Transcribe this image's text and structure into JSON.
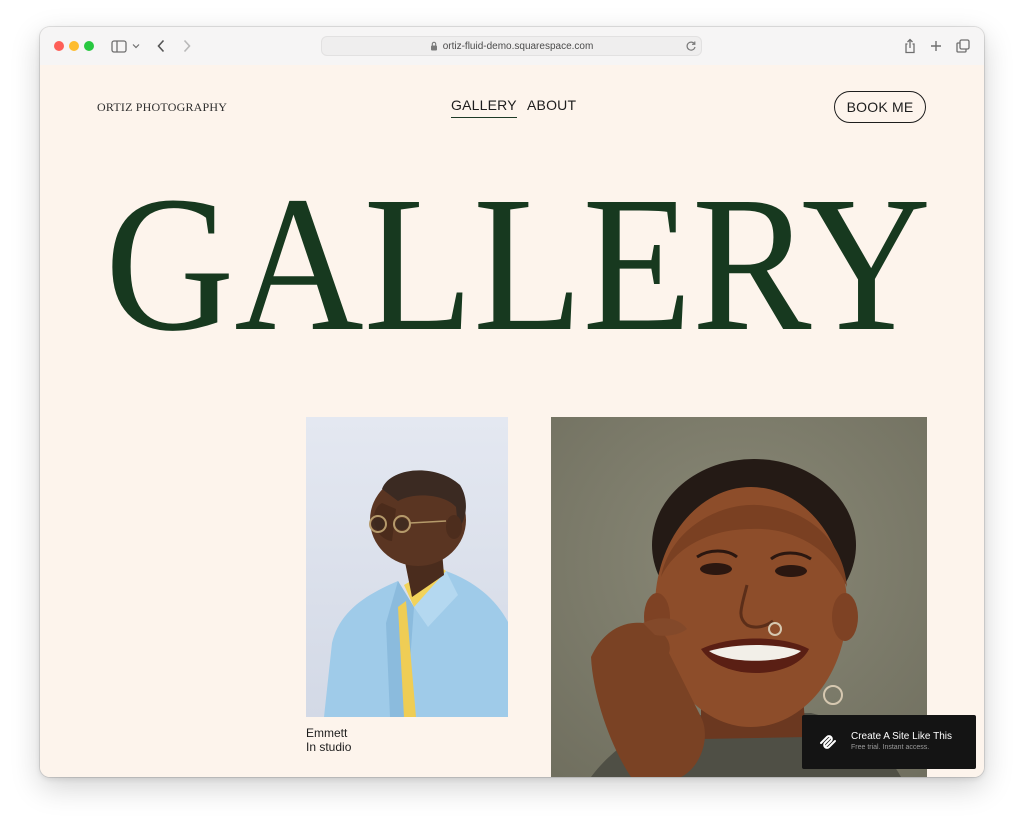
{
  "browser": {
    "url": "ortiz-fluid-demo.squarespace.com"
  },
  "site": {
    "logo": "ORTIZ PHOTOGRAPHY",
    "nav": {
      "gallery": "GALLERY",
      "about": "ABOUT"
    },
    "book_button": "BOOK ME",
    "hero_title": "GALLERY",
    "colors": {
      "background": "#fdf4ec",
      "title_green": "#17391f",
      "text": "#1d1d1d"
    }
  },
  "gallery": {
    "items": [
      {
        "caption_name": "Emmett",
        "caption_sub": "In studio"
      }
    ]
  },
  "promo": {
    "title": "Create A Site Like This",
    "subtitle": "Free trial. Instant access."
  }
}
